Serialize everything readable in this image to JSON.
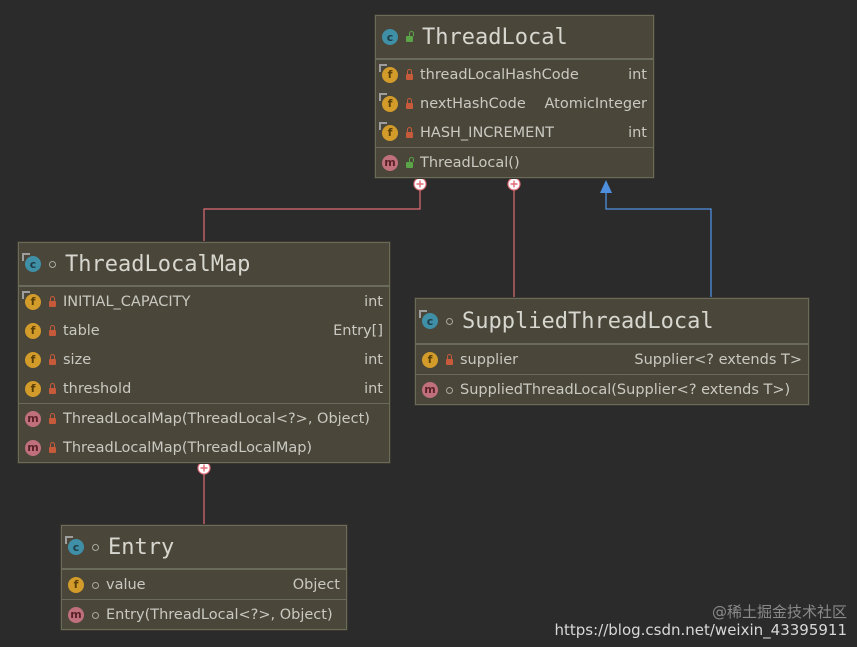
{
  "classes": {
    "threadlocal": {
      "name": "ThreadLocal",
      "fields": [
        {
          "name": "threadLocalHashCode",
          "type": "int"
        },
        {
          "name": "nextHashCode",
          "type": "AtomicInteger"
        },
        {
          "name": "HASH_INCREMENT",
          "type": "int"
        }
      ],
      "methods": [
        {
          "name": "ThreadLocal()"
        }
      ]
    },
    "threadlocalmap": {
      "name": "ThreadLocalMap",
      "fields": [
        {
          "name": "INITIAL_CAPACITY",
          "type": "int"
        },
        {
          "name": "table",
          "type": "Entry[]"
        },
        {
          "name": "size",
          "type": "int"
        },
        {
          "name": "threshold",
          "type": "int"
        }
      ],
      "methods": [
        {
          "name": "ThreadLocalMap(ThreadLocal<?>, Object)"
        },
        {
          "name": "ThreadLocalMap(ThreadLocalMap)"
        }
      ]
    },
    "suppliedthreadlocal": {
      "name": "SuppliedThreadLocal",
      "fields": [
        {
          "name": "supplier",
          "type": "Supplier<? extends T>"
        }
      ],
      "methods": [
        {
          "name": "SuppliedThreadLocal(Supplier<? extends T>)"
        }
      ]
    },
    "entry": {
      "name": "Entry",
      "fields": [
        {
          "name": "value",
          "type": "Object"
        }
      ],
      "methods": [
        {
          "name": "Entry(ThreadLocal<?>, Object)"
        }
      ]
    }
  },
  "colors": {
    "nested_link": "#e06c75",
    "inherit_link": "#4f8fe0"
  },
  "watermark": {
    "line1": "@稀土掘金技术社区",
    "line2": "https://blog.csdn.net/weixin_43395911"
  }
}
